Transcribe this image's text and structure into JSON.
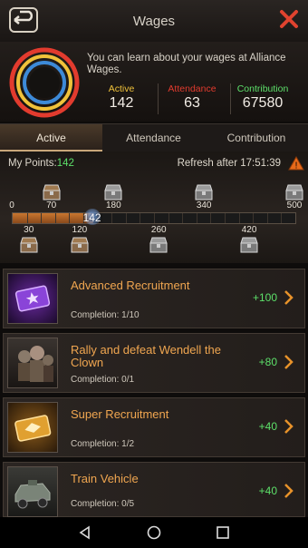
{
  "header": {
    "title": "Wages",
    "back_icon": "back-arrow-icon",
    "close_icon": "close-x-icon"
  },
  "summary": {
    "description": "You can learn about your wages at Alliance Wages.",
    "stats": [
      {
        "label": "Active",
        "value": "142",
        "color": "#f0c23a"
      },
      {
        "label": "Attendance",
        "value": "63",
        "color": "#e23b2e"
      },
      {
        "label": "Contribution",
        "value": "67580",
        "color": "#5de06a"
      }
    ]
  },
  "tabs": [
    {
      "label": "Active",
      "selected": true
    },
    {
      "label": "Attendance",
      "selected": false
    },
    {
      "label": "Contribution",
      "selected": false
    }
  ],
  "points": {
    "label": "My Points:",
    "value": "142",
    "refresh": "Refresh after 17:51:39",
    "current_display": "142",
    "current": 142,
    "max": 500,
    "milestones_top": [
      "0",
      "70",
      "180",
      "340",
      "500"
    ],
    "milestones_bottom": [
      "30",
      "120",
      "260",
      "420"
    ],
    "chests_top": [
      70,
      180,
      340,
      500
    ],
    "chests_bottom": [
      30,
      120,
      260,
      420
    ]
  },
  "tasks": [
    {
      "name": "Advanced Recruitment",
      "completion": "Completion: 1/10",
      "reward": "+100",
      "icon": "purple-ticket-icon"
    },
    {
      "name": "Rally and defeat Wendell the Clown",
      "completion": "Completion: 0/1",
      "reward": "+80",
      "icon": "zombie-boss-icon"
    },
    {
      "name": "Super Recruitment",
      "completion": "Completion: 1/2",
      "reward": "+40",
      "icon": "gold-ticket-icon"
    },
    {
      "name": "Train Vehicle",
      "completion": "Completion: 0/5",
      "reward": "+40",
      "icon": "armored-vehicle-icon"
    }
  ],
  "navbar": {
    "back": "nav-back-icon",
    "home": "nav-home-icon",
    "recent": "nav-recent-icon"
  }
}
